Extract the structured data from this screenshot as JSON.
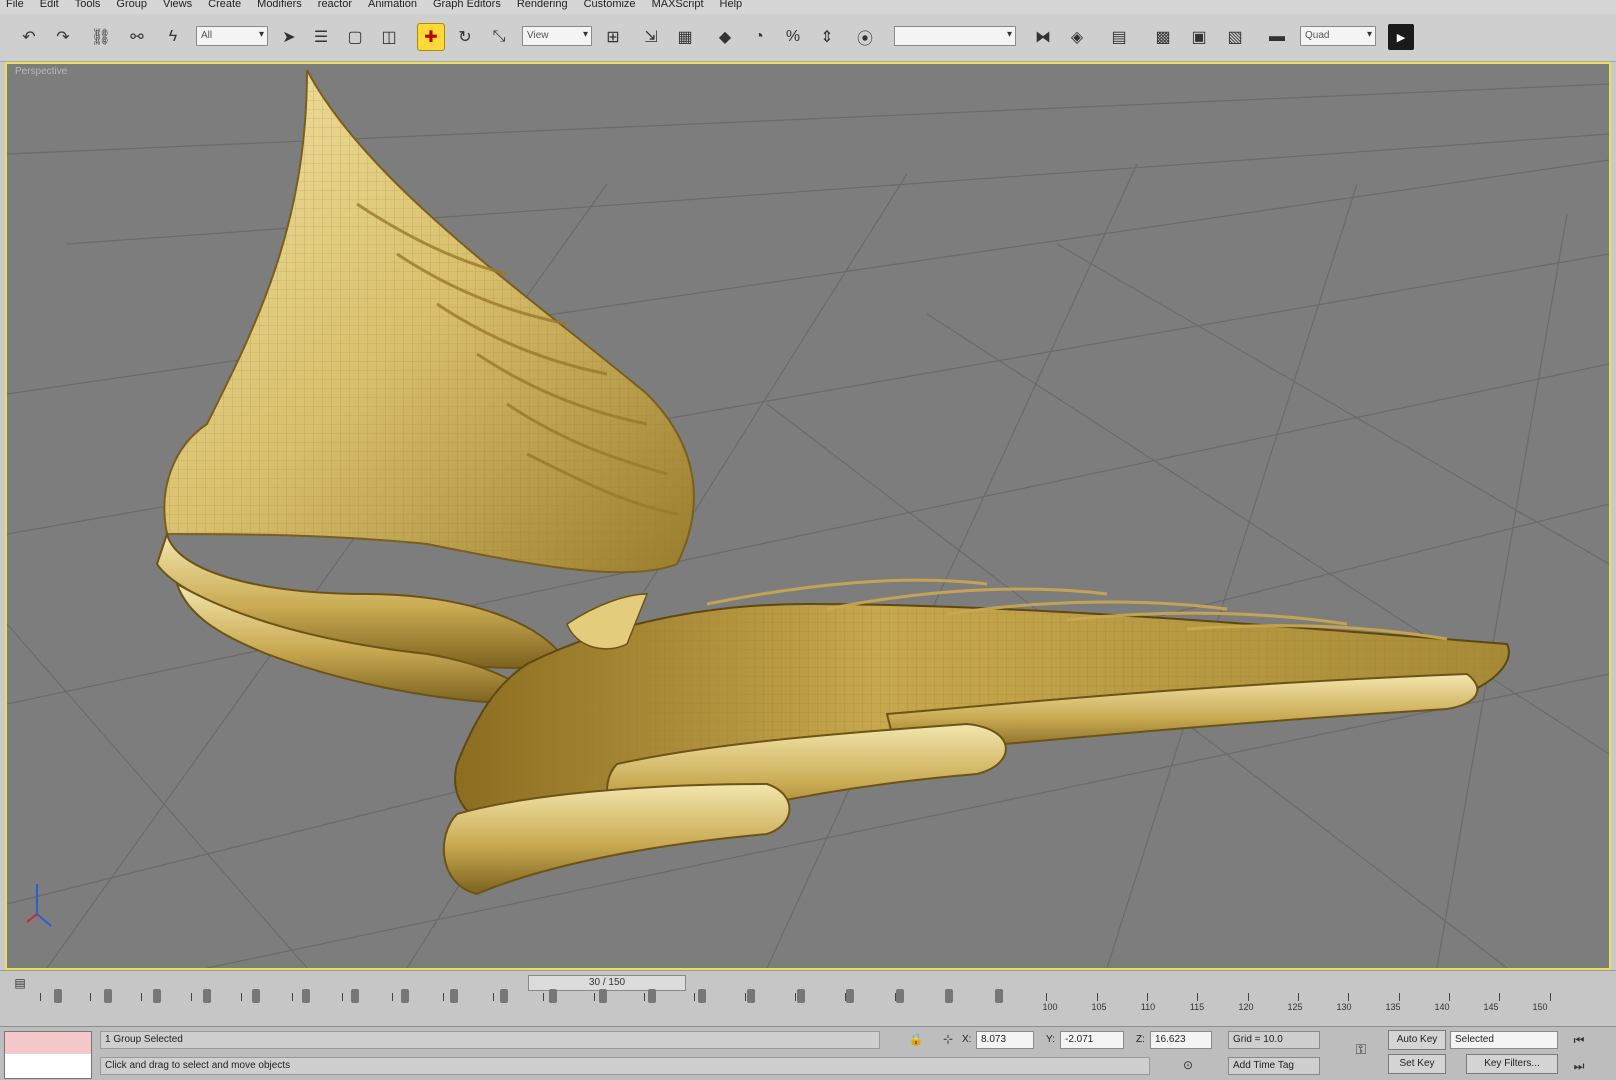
{
  "menu": [
    {
      "label": "File"
    },
    {
      "label": "Edit"
    },
    {
      "label": "Tools"
    },
    {
      "label": "Group"
    },
    {
      "label": "Views"
    },
    {
      "label": "Create"
    },
    {
      "label": "Modifiers"
    },
    {
      "label": "reactor"
    },
    {
      "label": "Animation"
    },
    {
      "label": "Graph Editors"
    },
    {
      "label": "Rendering"
    },
    {
      "label": "Customize"
    },
    {
      "label": "MAXScript"
    },
    {
      "label": "Help"
    }
  ],
  "toolbar": {
    "selection_filter": "All",
    "reference_coord": "View",
    "named_selection": "",
    "render_preset": "Quad"
  },
  "viewport": {
    "label": "Perspective"
  },
  "timeline": {
    "slider_label": "30 / 150",
    "tick_labels": [
      "100",
      "105",
      "110",
      "115",
      "120",
      "125",
      "130",
      "135",
      "140",
      "145",
      "150"
    ]
  },
  "status": {
    "selection_info": "1 Group Selected",
    "prompt": "Click and drag to select and move objects",
    "x_label": "X:",
    "x_value": "8.073",
    "y_label": "Y:",
    "y_value": "-2.071",
    "z_label": "Z:",
    "z_value": "16.623",
    "grid": "Grid = 10.0",
    "add_time_tag": "Add Time Tag",
    "auto_key": "Auto Key",
    "set_key": "Set Key",
    "key_mode": "Selected",
    "key_filters": "Key Filters..."
  },
  "colors": {
    "viewport_bg": "#7d7d7d",
    "model_gold": "#c8a64a",
    "active_border": "#e8e05a"
  }
}
